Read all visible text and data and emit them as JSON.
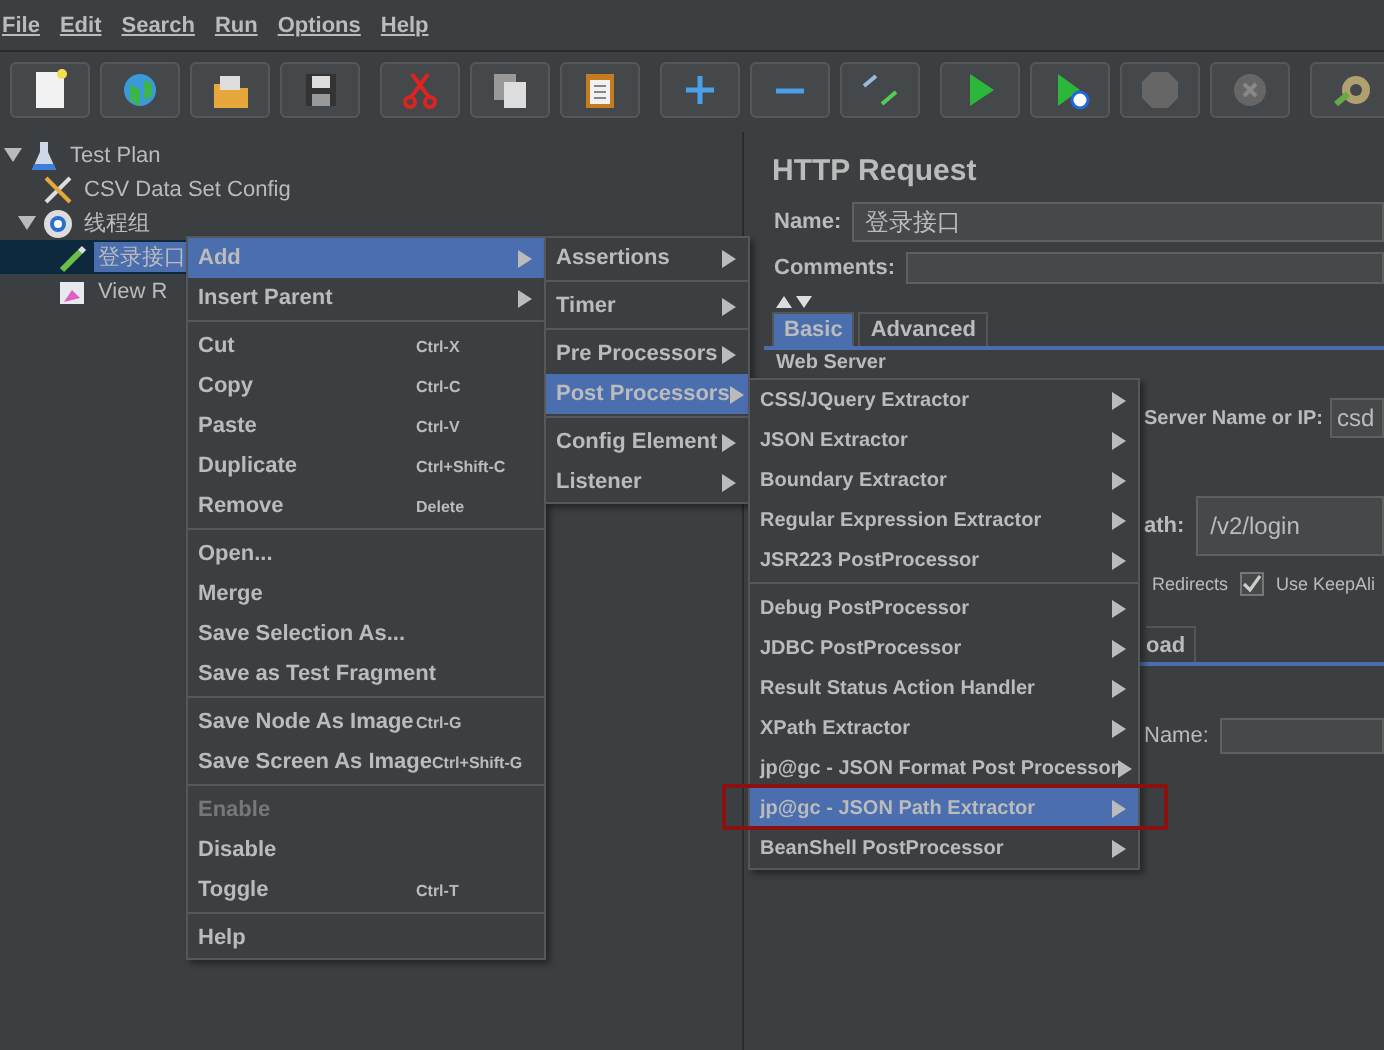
{
  "menu_bar": [
    {
      "label": "File"
    },
    {
      "label": "Edit"
    },
    {
      "label": "Search"
    },
    {
      "label": "Run"
    },
    {
      "label": "Options"
    },
    {
      "label": "Help"
    }
  ],
  "tree": [
    {
      "label": "Test Plan",
      "kind": "plan",
      "selected": false,
      "expanded": true,
      "children": [
        {
          "label": "CSV Data Set Config",
          "kind": "config",
          "selected": false
        },
        {
          "label": "线程组",
          "kind": "thread_group",
          "selected": false,
          "expanded": true,
          "children": [
            {
              "label": "登录接口",
              "kind": "sampler",
              "selected": true
            },
            {
              "label": "View R",
              "kind": "listener",
              "selected": false
            }
          ]
        }
      ]
    }
  ],
  "context_menu": {
    "sections": [
      [
        {
          "label": "Add",
          "submenu": true,
          "selected": true,
          "disabled": false
        },
        {
          "label": "Insert Parent",
          "submenu": true,
          "selected": false,
          "disabled": false
        }
      ],
      [
        {
          "label": "Cut",
          "shortcut": "Ctrl-X",
          "submenu": false,
          "selected": false,
          "disabled": false
        },
        {
          "label": "Copy",
          "shortcut": "Ctrl-C",
          "submenu": false,
          "selected": false,
          "disabled": false
        },
        {
          "label": "Paste",
          "shortcut": "Ctrl-V",
          "submenu": false,
          "selected": false,
          "disabled": false
        },
        {
          "label": "Duplicate",
          "shortcut": "Ctrl+Shift-C",
          "submenu": false,
          "selected": false,
          "disabled": false
        },
        {
          "label": "Remove",
          "shortcut": "Delete",
          "submenu": false,
          "selected": false,
          "disabled": false
        }
      ],
      [
        {
          "label": "Open...",
          "submenu": false,
          "selected": false,
          "disabled": false
        },
        {
          "label": "Merge",
          "submenu": false,
          "selected": false,
          "disabled": false
        },
        {
          "label": "Save Selection As...",
          "submenu": false,
          "selected": false,
          "disabled": false
        },
        {
          "label": "Save as Test Fragment",
          "submenu": false,
          "selected": false,
          "disabled": false
        }
      ],
      [
        {
          "label": "Save Node As Image",
          "shortcut": "Ctrl-G",
          "submenu": false,
          "selected": false,
          "disabled": false
        },
        {
          "label": "Save Screen As Image",
          "shortcut": "Ctrl+Shift-G",
          "submenu": false,
          "selected": false,
          "disabled": false
        }
      ],
      [
        {
          "label": "Enable",
          "submenu": false,
          "selected": false,
          "disabled": true
        },
        {
          "label": "Disable",
          "submenu": false,
          "selected": false,
          "disabled": false
        },
        {
          "label": "Toggle",
          "shortcut": "Ctrl-T",
          "submenu": false,
          "selected": false,
          "disabled": false
        }
      ],
      [
        {
          "label": "Help",
          "submenu": false,
          "selected": false,
          "disabled": false
        }
      ]
    ]
  },
  "add_menu": {
    "sections": [
      [
        {
          "label": "Assertions",
          "selected": false
        }
      ],
      [
        {
          "label": "Timer",
          "selected": false
        }
      ],
      [
        {
          "label": "Pre Processors",
          "selected": false
        },
        {
          "label": "Post Processors",
          "selected": true
        }
      ],
      [
        {
          "label": "Config Element",
          "selected": false
        },
        {
          "label": "Listener",
          "selected": false
        }
      ]
    ]
  },
  "post_processors_menu": {
    "sections": [
      [
        {
          "label": "CSS/JQuery Extractor",
          "selected": false,
          "outlined": false
        },
        {
          "label": "JSON Extractor",
          "selected": false,
          "outlined": false
        },
        {
          "label": "Boundary Extractor",
          "selected": false,
          "outlined": false
        },
        {
          "label": "Regular Expression Extractor",
          "selected": false,
          "outlined": false
        },
        {
          "label": "JSR223 PostProcessor",
          "selected": false,
          "outlined": false
        }
      ],
      [
        {
          "label": "Debug PostProcessor",
          "selected": false,
          "outlined": false
        },
        {
          "label": "JDBC PostProcessor",
          "selected": false,
          "outlined": false
        },
        {
          "label": "Result Status Action Handler",
          "selected": false,
          "outlined": false
        },
        {
          "label": "XPath Extractor",
          "selected": false,
          "outlined": false
        },
        {
          "label": "jp@gc - JSON Format Post Processor",
          "selected": false,
          "outlined": false
        },
        {
          "label": "jp@gc - JSON Path Extractor",
          "selected": true,
          "outlined": true
        },
        {
          "label": "BeanShell PostProcessor",
          "selected": false,
          "outlined": false
        }
      ]
    ]
  },
  "editor": {
    "title": "HTTP Request",
    "name_label": "Name:",
    "name_value": "登录接口",
    "comments_label": "Comments:",
    "tabs": [
      {
        "label": "Basic",
        "selected": true
      },
      {
        "label": "Advanced",
        "selected": false
      }
    ],
    "section_label": "Web Server",
    "server_label": "Server Name or IP:",
    "server_value": "csd",
    "path_label": "ath:",
    "path_value": "/v2/login",
    "redirects_label": "Redirects",
    "keepalive": {
      "label": "Use KeepAli",
      "checked": true
    },
    "body_tab": "oad",
    "param_label": "Name:"
  }
}
